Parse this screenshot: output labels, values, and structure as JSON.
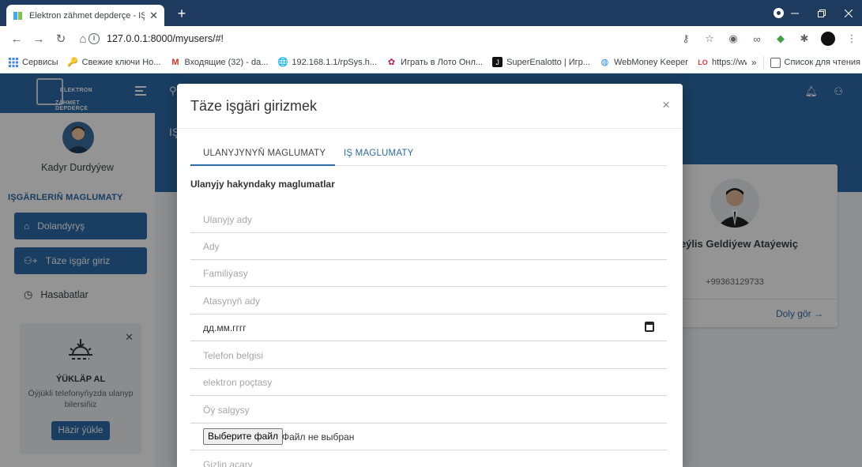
{
  "chrome": {
    "tab_title": "Elektron zähmet depderçe - IŞGÄ",
    "tab_close": "✕",
    "new_tab": "+",
    "url": "127.0.0.1:8000/myusers/#!",
    "bookmarks": [
      {
        "icon": "apps-icon",
        "label": "Сервисы"
      },
      {
        "icon": "key-icon",
        "label": "Свежие ключи Но..."
      },
      {
        "icon": "gmail-icon",
        "label": "Входящие (32) - da..."
      },
      {
        "icon": "globe-icon",
        "label": "192.168.1.1/rpSys.h..."
      },
      {
        "icon": "lotto-icon",
        "label": "Играть в Лото Онл..."
      },
      {
        "icon": "superenalotto-icon",
        "label": "SuperEnalotto | Игр..."
      },
      {
        "icon": "webmoney-icon",
        "label": "WebMoney Keeper"
      },
      {
        "icon": "lottery-icon",
        "label": "https://www.thelott..."
      }
    ],
    "bookmarks_more": "»",
    "reading_list": "Список для чтения"
  },
  "app": {
    "logo_line1": "ELEKTRON",
    "logo_line2": "ZÄHMET DEPDERÇE",
    "hero_title": "IŞ",
    "user_name": "Kadyr Durdyýew",
    "section_label": "IŞGÄRLERIŇ MAGLUMATY",
    "nav": [
      {
        "icon": "home-icon",
        "label": "Dolandyryş"
      },
      {
        "icon": "add-user-icon",
        "label": "Täze işgär giriz"
      },
      {
        "icon": "clock-icon",
        "label": "Hasabatlar"
      }
    ],
    "promo": {
      "title": "ÝÜKLÄP AL",
      "text": "Öýjükli telefonyňyzda ulanyp bilersiňiz",
      "button": "Häzir ýükle"
    },
    "profile": {
      "name": "Meýlis Geldiýew Ataýewiç",
      "phone": "+99363129733",
      "link": "Doly gör →"
    }
  },
  "modal": {
    "title": "Täze işgäri girizmek",
    "close": "×",
    "tabs": [
      "ULANYJYNYŇ MAGLUMATY",
      "IŞ MAGLUMATY"
    ],
    "section_title": "Ulanyjy hakyndaky maglumatlar",
    "fields": {
      "username": "Ulanyjy ady",
      "first_name": "Ady",
      "last_name": "Familiýasy",
      "father_name": "Atasynyň ady",
      "date": "дд.мм.гггг",
      "phone": "Telefon belgisi",
      "email": "elektron poçtasy",
      "address": "Öý salgysy",
      "password": "Gizlin açary"
    },
    "file": {
      "button": "Выберите файл",
      "status": "Файл не выбран"
    }
  }
}
